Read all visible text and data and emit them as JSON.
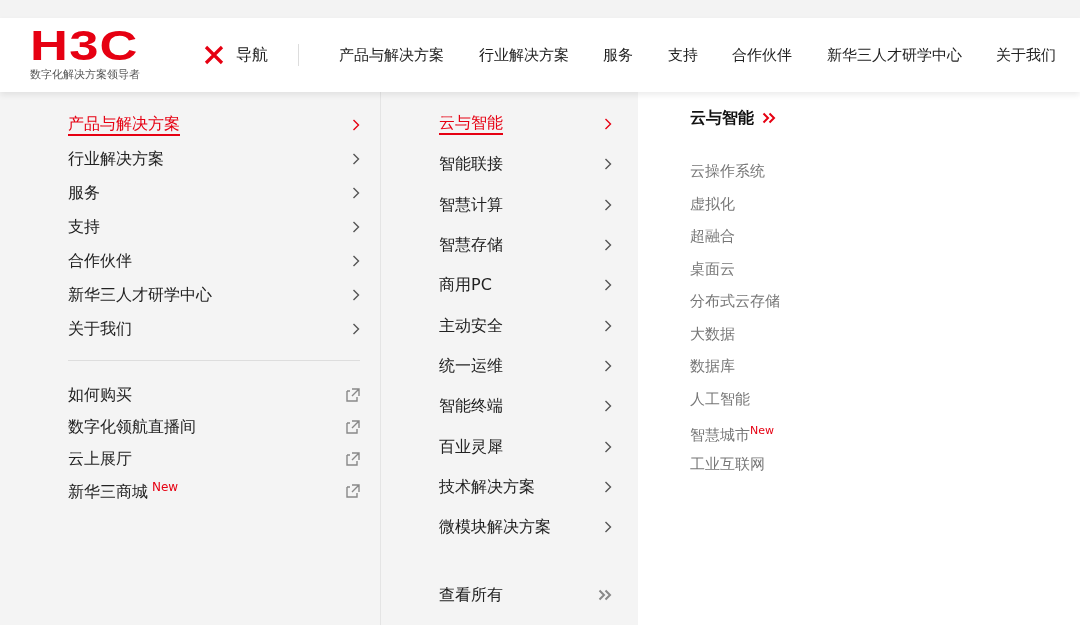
{
  "logo": {
    "text": "H3C",
    "tagline": "数字化解决方案领导者"
  },
  "nav_toggle": {
    "label": "导航"
  },
  "top_nav": [
    "产品与解决方案",
    "行业解决方案",
    "服务",
    "支持",
    "合作伙伴",
    "新华三人才研学中心",
    "关于我们"
  ],
  "menu": [
    {
      "label": "产品与解决方案",
      "selected": true
    },
    {
      "label": "行业解决方案",
      "selected": false
    },
    {
      "label": "服务",
      "selected": false
    },
    {
      "label": "支持",
      "selected": false
    },
    {
      "label": "合作伙伴",
      "selected": false
    },
    {
      "label": "新华三人才研学中心",
      "selected": false
    },
    {
      "label": "关于我们",
      "selected": false
    }
  ],
  "links": [
    {
      "label": "如何购买"
    },
    {
      "label": "数字化领航直播间"
    },
    {
      "label": "云上展厅"
    },
    {
      "label": "新华三商城",
      "badge": "New"
    }
  ],
  "submenu": [
    {
      "label": "云与智能",
      "selected": true
    },
    {
      "label": "智能联接",
      "selected": false
    },
    {
      "label": "智慧计算",
      "selected": false
    },
    {
      "label": "智慧存储",
      "selected": false
    },
    {
      "label": "商用PC",
      "selected": false
    },
    {
      "label": "主动安全",
      "selected": false
    },
    {
      "label": "统一运维",
      "selected": false
    },
    {
      "label": "智能终端",
      "selected": false
    },
    {
      "label": "百业灵犀",
      "selected": false
    },
    {
      "label": "技术解决方案",
      "selected": false
    },
    {
      "label": "微模块解决方案",
      "selected": false
    }
  ],
  "view_all": "查看所有",
  "detail": {
    "title": "云与智能",
    "items": [
      {
        "label": "云操作系统"
      },
      {
        "label": "虚拟化"
      },
      {
        "label": "超融合"
      },
      {
        "label": "桌面云"
      },
      {
        "label": "分布式云存储"
      },
      {
        "label": "大数据"
      },
      {
        "label": "数据库"
      },
      {
        "label": "人工智能"
      },
      {
        "label": "智慧城市",
        "badge": "New"
      },
      {
        "label": "工业互联网"
      }
    ]
  }
}
